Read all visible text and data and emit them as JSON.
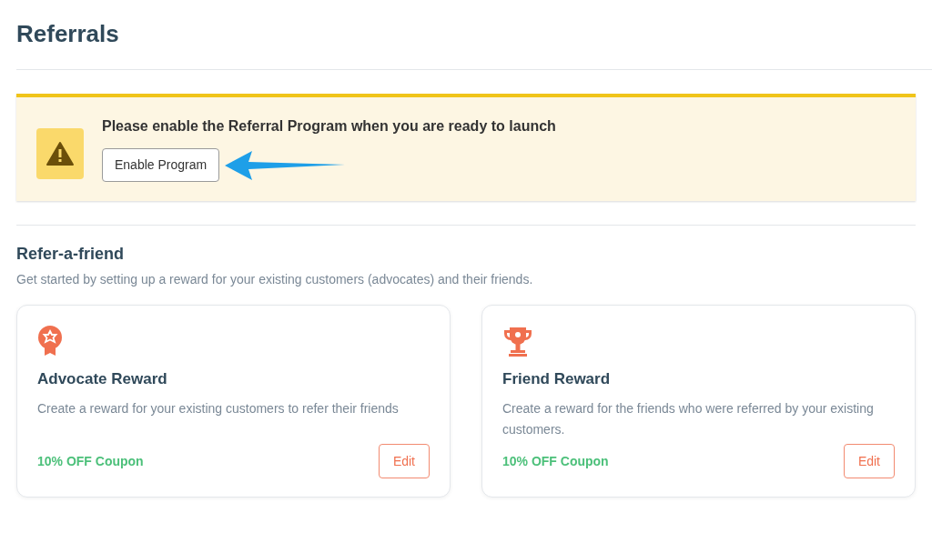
{
  "page": {
    "title": "Referrals"
  },
  "banner": {
    "message": "Please enable the Referral Program when you are ready to launch",
    "button": "Enable Program"
  },
  "section": {
    "title": "Refer-a-friend",
    "subtitle": "Get started by setting up a reward for your existing customers (advocates) and their friends."
  },
  "cards": [
    {
      "kind": "medal",
      "title": "Advocate Reward",
      "description": "Create a reward for your existing customers to refer their friends",
      "reward": "10% OFF Coupon",
      "button": "Edit"
    },
    {
      "kind": "trophy",
      "title": "Friend Reward",
      "description": "Create a reward for the friends who were referred by your existing customers.",
      "reward": "10% OFF Coupon",
      "button": "Edit"
    }
  ]
}
